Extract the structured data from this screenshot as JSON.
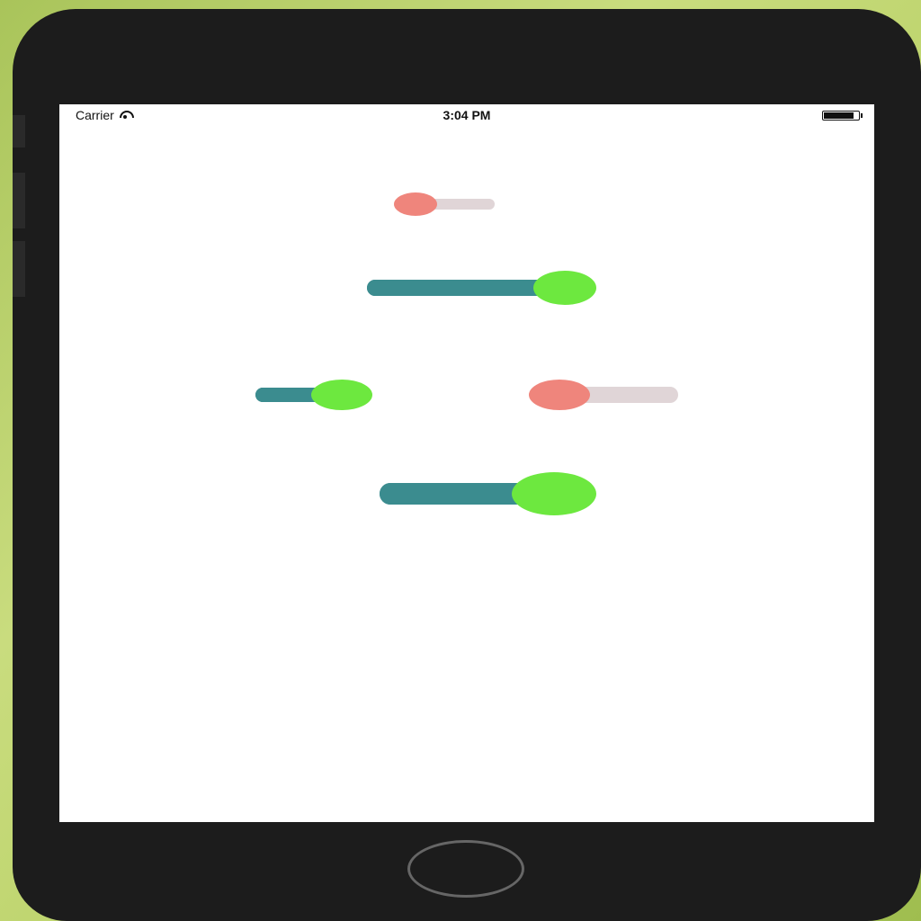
{
  "status_bar": {
    "carrier": "Carrier",
    "time": "3:04 PM"
  },
  "colors": {
    "track_filled": "#3b8c8f",
    "track_empty": "#e0d5d7",
    "thumb_green": "#6de83f",
    "thumb_red": "#ef857c"
  },
  "sliders": [
    {
      "name": "slider-1",
      "value": 0.0,
      "thumb_color": "#ef857c",
      "fill_color": "#ef857c",
      "track_color": "#e0d5d7"
    },
    {
      "name": "slider-2",
      "value": 1.0,
      "thumb_color": "#6de83f",
      "fill_color": "#3b8c8f",
      "track_color": "#3b8c8f"
    },
    {
      "name": "slider-3",
      "value": 1.0,
      "thumb_color": "#6de83f",
      "fill_color": "#3b8c8f",
      "track_color": "#3b8c8f"
    },
    {
      "name": "slider-4",
      "value": 0.0,
      "thumb_color": "#ef857c",
      "fill_color": "#ef857c",
      "track_color": "#e0d5d7"
    },
    {
      "name": "slider-5",
      "value": 1.0,
      "thumb_color": "#6de83f",
      "fill_color": "#3b8c8f",
      "track_color": "#3b8c8f"
    }
  ]
}
